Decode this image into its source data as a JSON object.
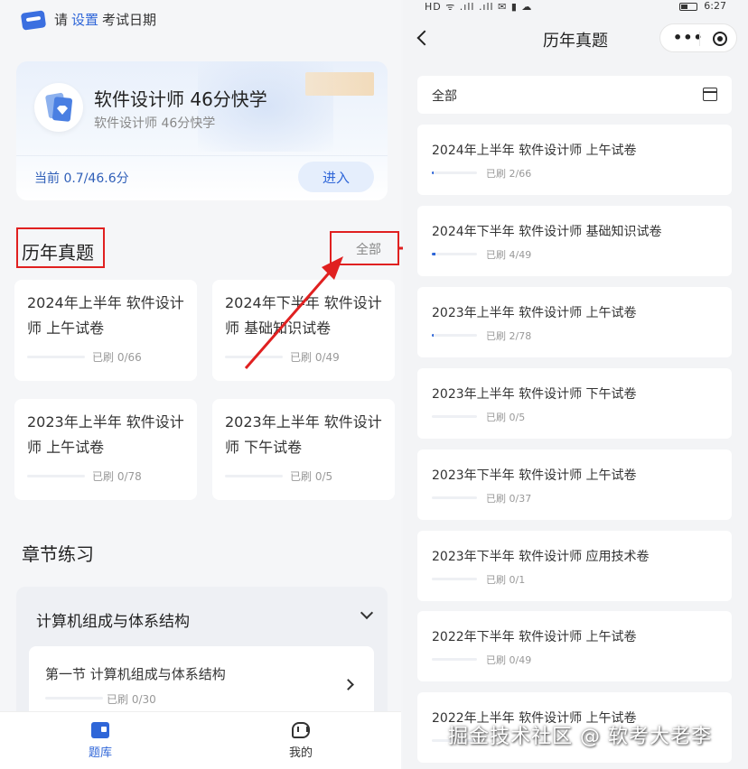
{
  "left": {
    "exam_prompt": {
      "prefix": "请",
      "link": "设置",
      "suffix": "考试日期"
    },
    "course": {
      "title": "软件设计师 46分快学",
      "subtitle": "软件设计师 46分快学",
      "progress": "当前 0.7/46.6分",
      "enter_label": "进入"
    },
    "past_papers": {
      "title": "历年真题",
      "all_label": "全部",
      "cards": [
        {
          "title": "2024年上半年 软件设计师 上午试卷",
          "count": "已刷 0/66"
        },
        {
          "title": "2024年下半年 软件设计师 基础知识试卷",
          "count": "已刷 0/49"
        },
        {
          "title": "2023年上半年 软件设计师 上午试卷",
          "count": "已刷 0/78"
        },
        {
          "title": "2023年上半年 软件设计师 下午试卷",
          "count": "已刷 0/5"
        }
      ]
    },
    "chapters": {
      "title": "章节练习",
      "group_title": "计算机组成与体系结构",
      "section_title": "第一节 计算机组成与体系结构",
      "section_count": "已刷 0/30"
    },
    "tabbar": {
      "tab1": "题库",
      "tab2": "我的"
    }
  },
  "right": {
    "status": {
      "left": "HD ᯤ .ıll .ıll ✉ ▮ ☁",
      "time": "6:27"
    },
    "nav": {
      "title": "历年真题",
      "more": "•••"
    },
    "filter": {
      "label": "全部"
    },
    "items": [
      {
        "title": "2024年上半年 软件设计师 上午试卷",
        "count": "已刷 2/66",
        "progress": 0.03
      },
      {
        "title": "2024年下半年 软件设计师 基础知识试卷",
        "count": "已刷 4/49",
        "progress": 0.08
      },
      {
        "title": "2023年上半年 软件设计师 上午试卷",
        "count": "已刷 2/78",
        "progress": 0.03
      },
      {
        "title": "2023年上半年 软件设计师 下午试卷",
        "count": "已刷 0/5",
        "progress": 0
      },
      {
        "title": "2023年下半年 软件设计师 上午试卷",
        "count": "已刷 0/37",
        "progress": 0
      },
      {
        "title": "2023年下半年 软件设计师 应用技术卷",
        "count": "已刷 0/1",
        "progress": 0
      },
      {
        "title": "2022年下半年 软件设计师 上午试卷",
        "count": "已刷 0/49",
        "progress": 0
      },
      {
        "title": "2022年上半年 软件设计师 上午试卷",
        "count": "",
        "progress": 0
      }
    ]
  },
  "watermark": "掘金技术社区 @ 软考大老李",
  "colors": {
    "accent": "#2f66d8",
    "highlight": "#e02020"
  }
}
